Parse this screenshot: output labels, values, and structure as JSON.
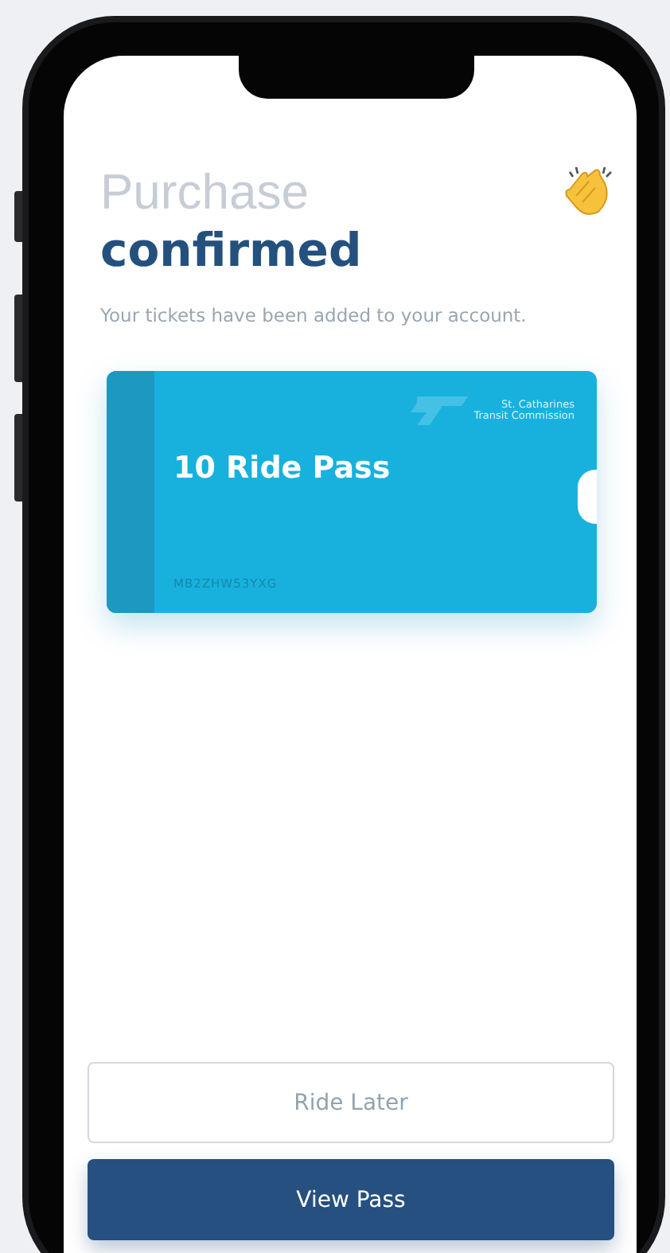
{
  "heading": {
    "light": "Purchase",
    "bold": "confirmed"
  },
  "subtitle": "Your tickets have been added to your account.",
  "ticket": {
    "name": "10 Ride Pass",
    "code": "MB2ZHW53YXG",
    "logo_text": [
      "St. Catharines",
      "Transit Commission"
    ]
  },
  "buttons": [
    {
      "label": "Ride Later",
      "kind": "secondary"
    },
    {
      "label": "View Pass",
      "kind": "primary"
    }
  ]
}
